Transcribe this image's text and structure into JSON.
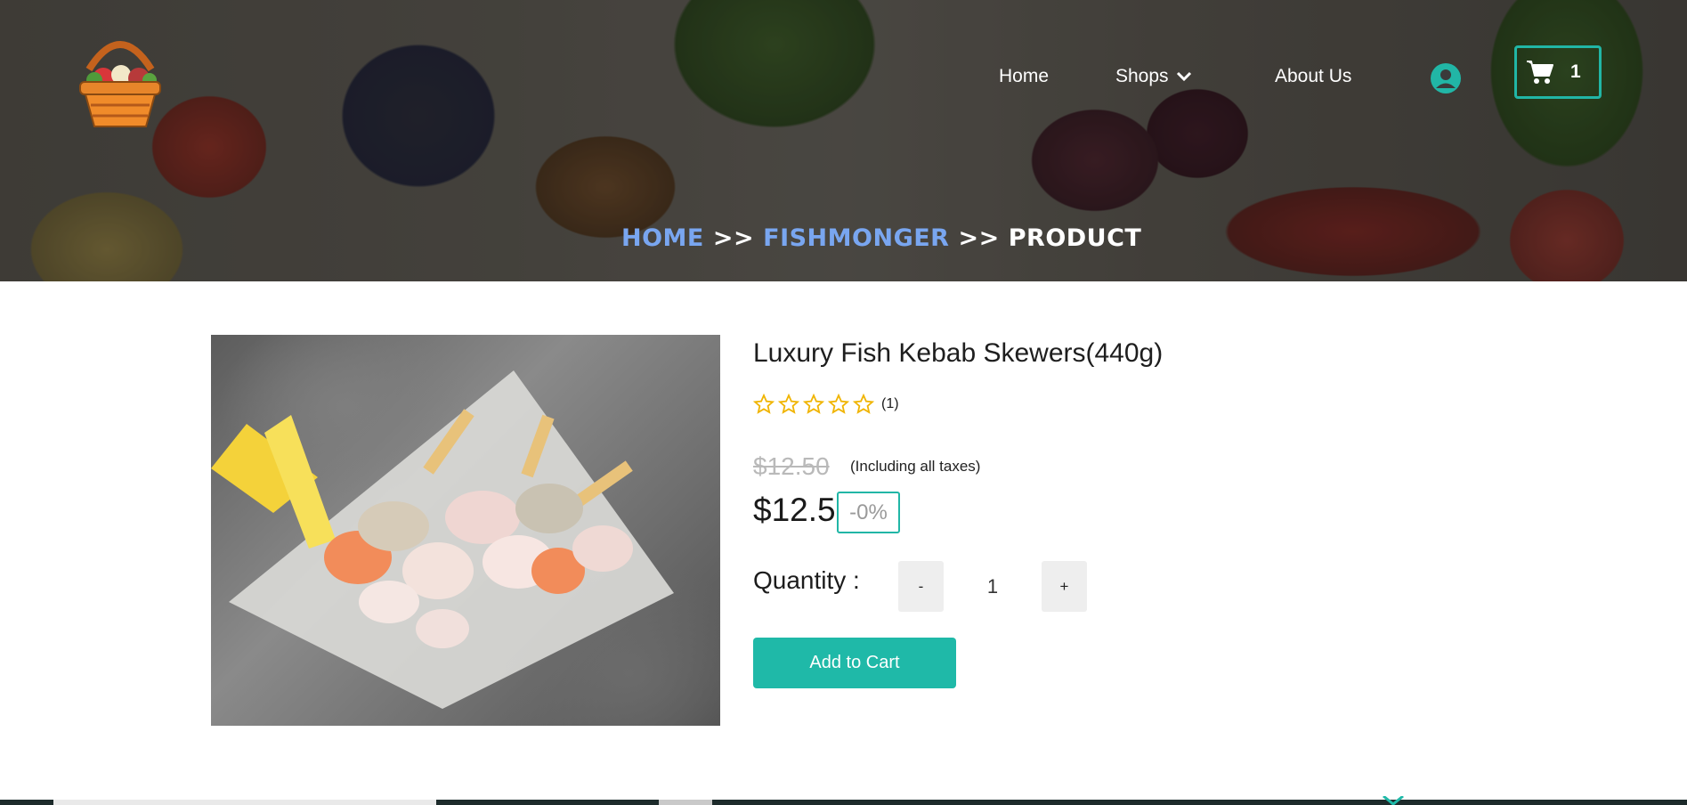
{
  "header": {
    "nav": {
      "home": "Home",
      "shops": "Shops",
      "about": "About Us"
    },
    "cart_count": "1",
    "icons": {
      "logo": "basket-logo",
      "user": "user-account-icon",
      "cart": "shopping-cart-icon",
      "shops_dropdown": "chevron-down-icon"
    }
  },
  "breadcrumb": {
    "home": "HOME",
    "separator": ">>",
    "category": "FISHMONGER",
    "current": "PRODUCT"
  },
  "product": {
    "title": "Luxury Fish Kebab Skewers(440g)",
    "rating": {
      "stars_filled": 0,
      "stars_total": 5,
      "count": "(1)"
    },
    "old_price": "$12.50",
    "tax_note": "(Including all taxes)",
    "price": "$12.5",
    "discount": "-0%",
    "quantity_label": "Quantity :",
    "quantity_value": "1",
    "minus_label": "-",
    "plus_label": "+",
    "add_to_cart_label": "Add to Cart"
  },
  "colors": {
    "accent": "#1fb9a8",
    "breadcrumb_link": "#79a6f0",
    "star": "#f0b400"
  }
}
